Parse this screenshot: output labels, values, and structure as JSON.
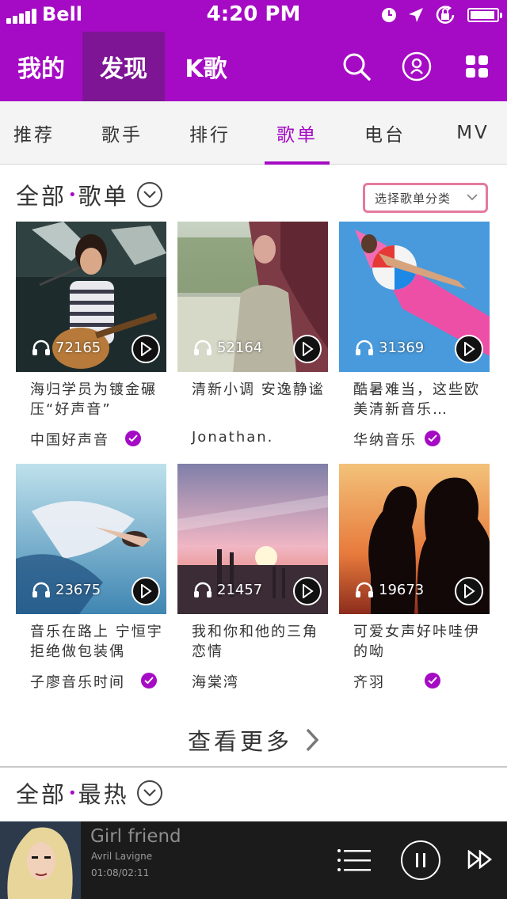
{
  "status": {
    "carrier": "Bell",
    "time": "4:20 PM"
  },
  "header": {
    "tabs": [
      {
        "label": "我的"
      },
      {
        "label": "发现"
      },
      {
        "label": "K歌"
      }
    ],
    "active_tab": "发现",
    "icons": [
      "search-icon",
      "user-icon",
      "grid-icon"
    ]
  },
  "subtabs": [
    {
      "label": "推荐"
    },
    {
      "label": "歌手"
    },
    {
      "label": "排行"
    },
    {
      "label": "歌单"
    },
    {
      "label": "电台"
    },
    {
      "label": "MV"
    }
  ],
  "active_subtab": "歌单",
  "section1": {
    "title_a": "全部",
    "title_b": "歌单",
    "select_label": "选择歌单分类"
  },
  "playlists": [
    {
      "count": "72165",
      "title": "海归学员为镀金碾压“好声音”",
      "author": "中国好声音",
      "verified": true
    },
    {
      "count": "52164",
      "title": "清新小调 安逸静谧",
      "author": "Jonathan.",
      "verified": false
    },
    {
      "count": "31369",
      "title": "酷暑难当，这些欧美清新音乐…",
      "author": "华纳音乐",
      "verified": true
    },
    {
      "count": "23675",
      "title": "音乐在路上 宁恒宇拒绝做包装偶",
      "author": "子廖音乐时间",
      "verified": true
    },
    {
      "count": "21457",
      "title": "我和你和他的三角恋情",
      "author": "海棠湾",
      "verified": false
    },
    {
      "count": "19673",
      "title": "可爱女声好咔哇伊的呦",
      "author": "齐羽",
      "verified": true
    }
  ],
  "more_label": "查看更多",
  "section2": {
    "title_a": "全部",
    "title_b": "最热"
  },
  "player": {
    "song": "Girl friend",
    "artist": "Avril Lavigne",
    "time": "01:08/02:11"
  },
  "colors": {
    "accent": "#a50bc4",
    "accent_dark": "#7d1595",
    "select_border": "#e47aa0",
    "player_bg": "#1b1b1b"
  }
}
